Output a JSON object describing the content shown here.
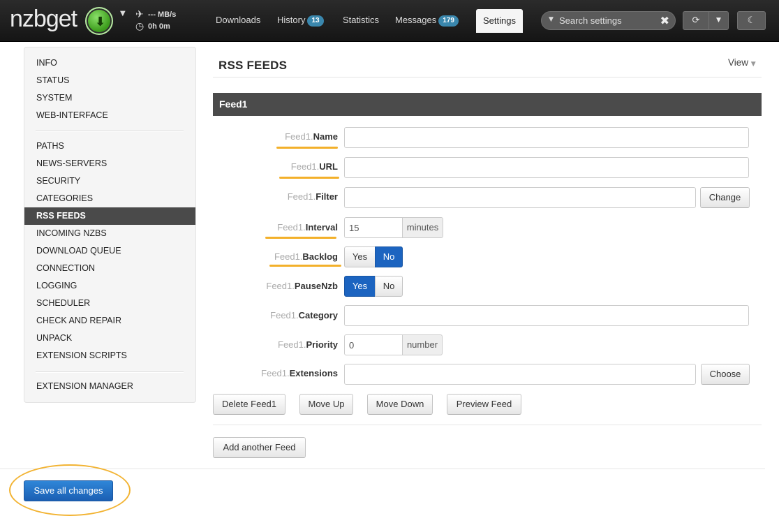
{
  "app": {
    "brand": "nzbget",
    "speed": "--- MB/s",
    "remaining_time": "0h 0m"
  },
  "nav": {
    "tabs": [
      {
        "label": "Downloads"
      },
      {
        "label": "History",
        "badge": "13"
      },
      {
        "label": "Statistics"
      },
      {
        "label": "Messages",
        "badge": "179"
      },
      {
        "label": "Settings"
      }
    ],
    "search_placeholder": "Search settings",
    "icons": [
      "download-icon",
      "plane-icon",
      "clock-icon",
      "refresh-icon",
      "caret-down-icon",
      "moon-icon",
      "clear-icon"
    ]
  },
  "sidebar": {
    "groups": [
      [
        "INFO",
        "STATUS",
        "SYSTEM",
        "WEB-INTERFACE"
      ],
      [
        "PATHS",
        "NEWS-SERVERS",
        "SECURITY",
        "CATEGORIES",
        "RSS FEEDS",
        "INCOMING NZBS",
        "DOWNLOAD QUEUE",
        "CONNECTION",
        "LOGGING",
        "SCHEDULER",
        "CHECK AND REPAIR",
        "UNPACK",
        "EXTENSION SCRIPTS"
      ],
      [
        "EXTENSION MANAGER"
      ]
    ],
    "active": "RSS FEEDS"
  },
  "main": {
    "title": "RSS FEEDS",
    "view_label": "View",
    "feed_title": "Feed1",
    "prefix": "Feed1.",
    "fields": {
      "name": "Name",
      "url": "URL",
      "filter": "Filter",
      "interval": "Interval",
      "backlog": "Backlog",
      "pausenzb": "PauseNzb",
      "category": "Category",
      "priority": "Priority",
      "extensions": "Extensions"
    },
    "values": {
      "name": "",
      "url": "",
      "filter": "",
      "interval": "15",
      "category": "",
      "priority": "0",
      "extensions": ""
    },
    "units": {
      "interval": "minutes",
      "priority": "number"
    },
    "buttons": {
      "change": "Change",
      "choose": "Choose",
      "yes": "Yes",
      "no": "No",
      "delete_feed": "Delete Feed1",
      "move_up": "Move Up",
      "move_down": "Move Down",
      "preview_feed": "Preview Feed",
      "add_feed": "Add another Feed",
      "save_all": "Save all changes"
    },
    "selected": {
      "backlog": "No",
      "pausenzb": "Yes"
    }
  },
  "colors": {
    "navbar": "#1f1f1f",
    "accent": "#1c64c0",
    "badge": "#3a87ad",
    "highlight": "#f3b02a",
    "sidebar_active": "#4a4a4a",
    "feed_header": "#4b4b4b"
  }
}
